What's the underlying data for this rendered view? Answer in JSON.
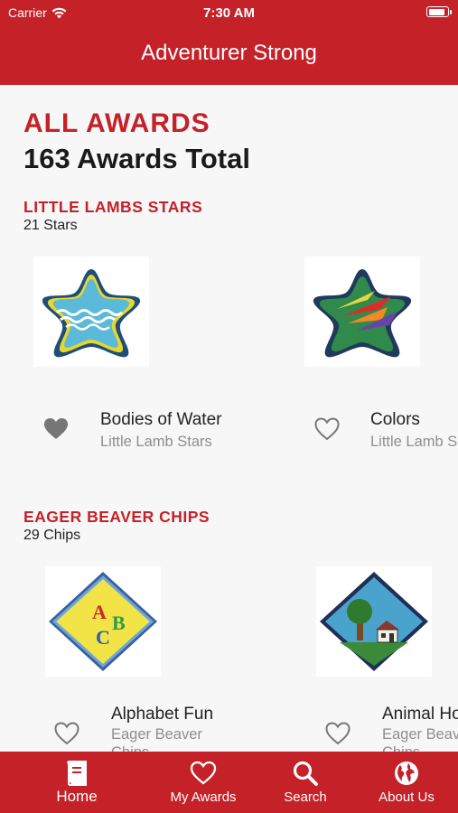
{
  "status": {
    "carrier": "Carrier",
    "time": "7:30 AM"
  },
  "header": {
    "title": "Adventurer Strong"
  },
  "summary": {
    "heading": "ALL AWARDS",
    "total": "163 Awards Total"
  },
  "sections": [
    {
      "title": "LITTLE LAMBS STARS",
      "count": "21 Stars",
      "awards": [
        {
          "name": "Bodies of Water",
          "category": "Little Lamb Stars",
          "favorited": true,
          "icon": "star-water-patch"
        },
        {
          "name": "Colors",
          "category": "Little Lamb S",
          "favorited": false,
          "icon": "star-colors-patch"
        }
      ]
    },
    {
      "title": "EAGER BEAVER CHIPS",
      "count": "29 Chips",
      "awards": [
        {
          "name": "Alphabet Fun",
          "category": "Eager Beaver",
          "category_line2": "Chips",
          "favorited": false,
          "icon": "diamond-abc-patch"
        },
        {
          "name": "Animal Ho",
          "category": "Eager Beav",
          "category_line2": "Chips",
          "favorited": false,
          "icon": "diamond-animal-home-patch"
        }
      ]
    }
  ],
  "tabs": [
    {
      "label": "Home",
      "icon": "book-icon",
      "active": true
    },
    {
      "label": "My Awards",
      "icon": "heart-outline-icon",
      "active": false
    },
    {
      "label": "Search",
      "icon": "search-icon",
      "active": false
    },
    {
      "label": "About Us",
      "icon": "globe-icon",
      "active": false
    }
  ],
  "colors": {
    "brand": "#c42128",
    "background": "#f7f7f7",
    "subtext": "#8e8e8e"
  }
}
